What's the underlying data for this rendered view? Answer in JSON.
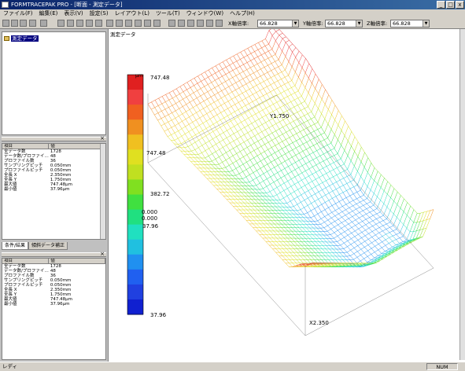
{
  "title": "FORMTRACEPAK PRO - [断面 - 測定データ]",
  "window_buttons": [
    "_",
    "□",
    "x"
  ],
  "menu": [
    "ファイル(F)",
    "編集(E)",
    "表示(V)",
    "設定(S)",
    "レイアウト(L)",
    "ツール(T)",
    "ウィンドウ(W)",
    "ヘルプ(H)"
  ],
  "zoom": {
    "x_label": "X軸倍率:",
    "x_value": "66.828",
    "y_label": "Y軸倍率:",
    "y_value": "66.828",
    "z_label": "Z軸倍率:",
    "z_value": "66.828"
  },
  "tree": {
    "root": "測定データ"
  },
  "props_header": {
    "item": "項目",
    "value": "値"
  },
  "props": [
    {
      "k": "全データ数",
      "v": "1728"
    },
    {
      "k": "データ数/プロファイ…",
      "v": "48"
    },
    {
      "k": "プロファイル数",
      "v": "36"
    },
    {
      "k": "サンプリングピッチ",
      "v": "0.050mm"
    },
    {
      "k": "プロファイルピッチ",
      "v": "0.050mm"
    },
    {
      "k": "全長 X",
      "v": "2.350mm"
    },
    {
      "k": "全長 Y",
      "v": "1.750mm"
    },
    {
      "k": "最大値",
      "v": "747.48μm"
    },
    {
      "k": "最小値",
      "v": "37.96μm"
    }
  ],
  "tabs": [
    "条件/結果",
    "傾斜データ補正"
  ],
  "document_title": "測定データ",
  "colorbar": {
    "unit": "μm",
    "max": "747.48",
    "mid": "382.72",
    "min": "37.96",
    "colors": [
      "#e02020",
      "#f04040",
      "#f06020",
      "#f09020",
      "#f0c020",
      "#e0e020",
      "#c0e020",
      "#80e020",
      "#40e040",
      "#20e080",
      "#20e0c0",
      "#20c0e0",
      "#2090f0",
      "#2060f0",
      "#2040e0",
      "#1020d0"
    ]
  },
  "plot_labels": {
    "y_axis": "Y1.750",
    "x_axis": "X2.350",
    "axis_val_top": "747.48",
    "axis_val_mid": "382.72",
    "axis_zero_1": "0.000",
    "axis_zero_2": "0.000",
    "axis_min": "37.96"
  },
  "status": {
    "left": "レディ",
    "num": "NUM"
  }
}
